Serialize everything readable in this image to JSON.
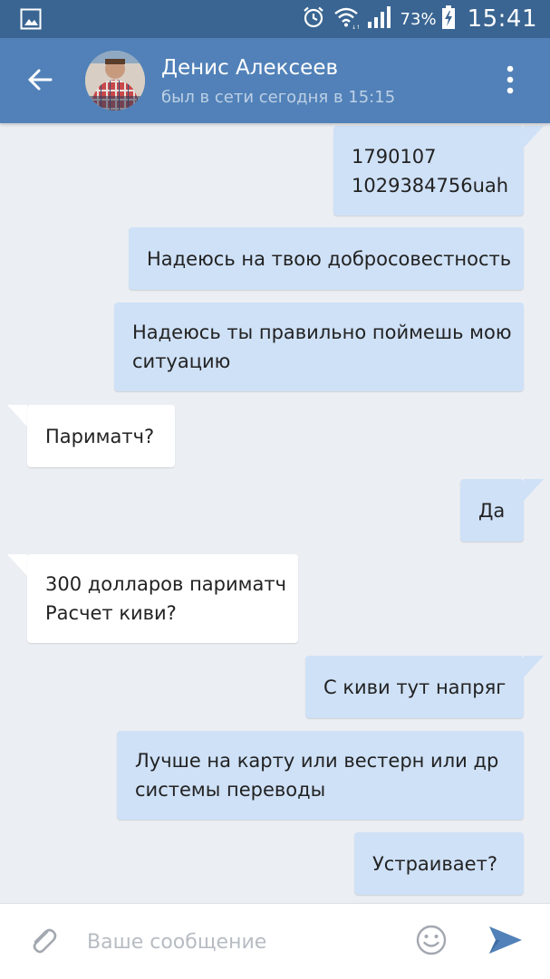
{
  "status_bar": {
    "battery": "73%",
    "time": "15:41",
    "icons": [
      "gallery-icon",
      "alarm-icon",
      "wifi-icon",
      "signal-icon",
      "battery-charging-icon"
    ]
  },
  "header": {
    "name": "Денис Алексеев",
    "status": "был в сети сегодня в 15:15",
    "accent_color": "#5181b8",
    "status_bar_color": "#3a6592"
  },
  "messages": [
    {
      "direction": "out",
      "lines": [
        "1790107",
        "1029384756uah"
      ]
    },
    {
      "direction": "out",
      "lines": [
        "Надеюсь на твою добросовестность"
      ]
    },
    {
      "direction": "out",
      "lines": [
        "Надеюсь ты правильно поймешь мою",
        "ситуацию"
      ]
    },
    {
      "direction": "in",
      "lines": [
        "Париматч?"
      ]
    },
    {
      "direction": "out",
      "lines": [
        "Да"
      ]
    },
    {
      "direction": "in",
      "lines": [
        "300 долларов париматч",
        "Расчет киви?"
      ]
    },
    {
      "direction": "out",
      "lines": [
        "С киви тут напряг"
      ]
    },
    {
      "direction": "out",
      "lines": [
        "Лучше на карту или вестерн или др",
        "системы переводы"
      ]
    },
    {
      "direction": "out",
      "lines": [
        "Устраивает?"
      ]
    }
  ],
  "input": {
    "placeholder": "Ваше сообщение",
    "value": ""
  },
  "colors": {
    "background": "#ebeef3",
    "outgoing_bubble": "#cfe1f7",
    "incoming_bubble": "#ffffff",
    "send_icon": "#5181b8"
  }
}
